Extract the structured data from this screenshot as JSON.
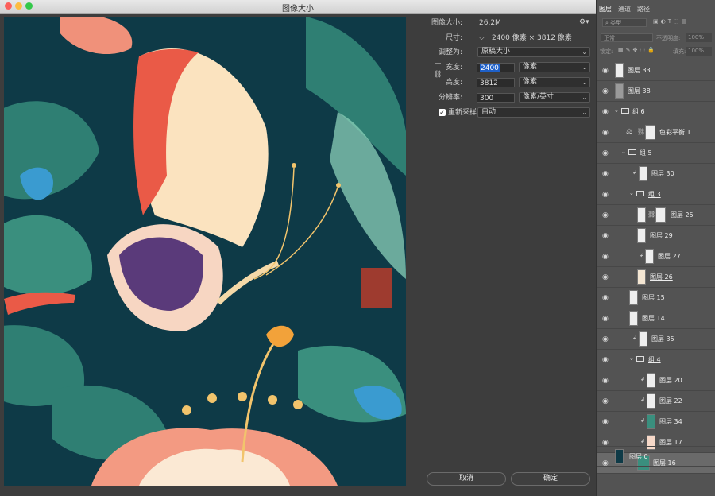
{
  "window": {
    "title": "图像大小"
  },
  "colors": {
    "accent": "#1e60c8",
    "dialog_bg": "#3d3d3d",
    "panel_bg": "#535353",
    "art_bg": "#0e3a47"
  },
  "dialog": {
    "image_size": {
      "label": "图像大小:",
      "value": "26.2M"
    },
    "dimensions": {
      "label": "尺寸:",
      "value": "2400 像素 × 3812 像素"
    },
    "fit_to": {
      "label": "调整为:",
      "value": "原稿大小"
    },
    "width": {
      "label": "宽度:",
      "value": "2400",
      "unit": "像素"
    },
    "height": {
      "label": "高度:",
      "value": "3812",
      "unit": "像素"
    },
    "resolution": {
      "label": "分辨率:",
      "value": "300",
      "unit": "像素/英寸"
    },
    "resample": {
      "label": "重新采样:",
      "value": "自动",
      "checked": true
    },
    "cancel_label": "取消",
    "ok_label": "确定"
  },
  "panel": {
    "tabs": [
      "图层",
      "通道",
      "路径"
    ],
    "filter_label": "类型",
    "blend_mode": "正常",
    "opacity_label": "不透明度:",
    "opacity_value": "100%",
    "lock_label": "锁定:",
    "fill_label": "填充:",
    "fill_value": "100%",
    "layers": [
      {
        "name": "图层 33",
        "indent": 0
      },
      {
        "name": "图层 38",
        "indent": 0
      },
      {
        "name": "组 6",
        "indent": 0,
        "type": "group"
      },
      {
        "name": "色彩平衡 1",
        "indent": 1,
        "type": "adjust"
      },
      {
        "name": "组 5",
        "indent": 1,
        "type": "group"
      },
      {
        "name": "图层 30",
        "indent": 2
      },
      {
        "name": "组 3",
        "indent": 2,
        "type": "group"
      },
      {
        "name": "图层 25",
        "indent": 3
      },
      {
        "name": "图层 29",
        "indent": 3
      },
      {
        "name": "图层 27",
        "indent": 3
      },
      {
        "name": "图层 26",
        "indent": 3
      },
      {
        "name": "图层 15",
        "indent": 1
      },
      {
        "name": "图层 14",
        "indent": 1
      },
      {
        "name": "图层 35",
        "indent": 2
      },
      {
        "name": "组 4",
        "indent": 2,
        "type": "group"
      },
      {
        "name": "图层 20",
        "indent": 3
      },
      {
        "name": "图层 22",
        "indent": 3
      },
      {
        "name": "图层 34",
        "indent": 3
      },
      {
        "name": "图层 17",
        "indent": 3
      },
      {
        "name": "图层 16",
        "indent": 3,
        "selected": true
      },
      {
        "name": "图层 0",
        "indent": 0
      }
    ]
  }
}
